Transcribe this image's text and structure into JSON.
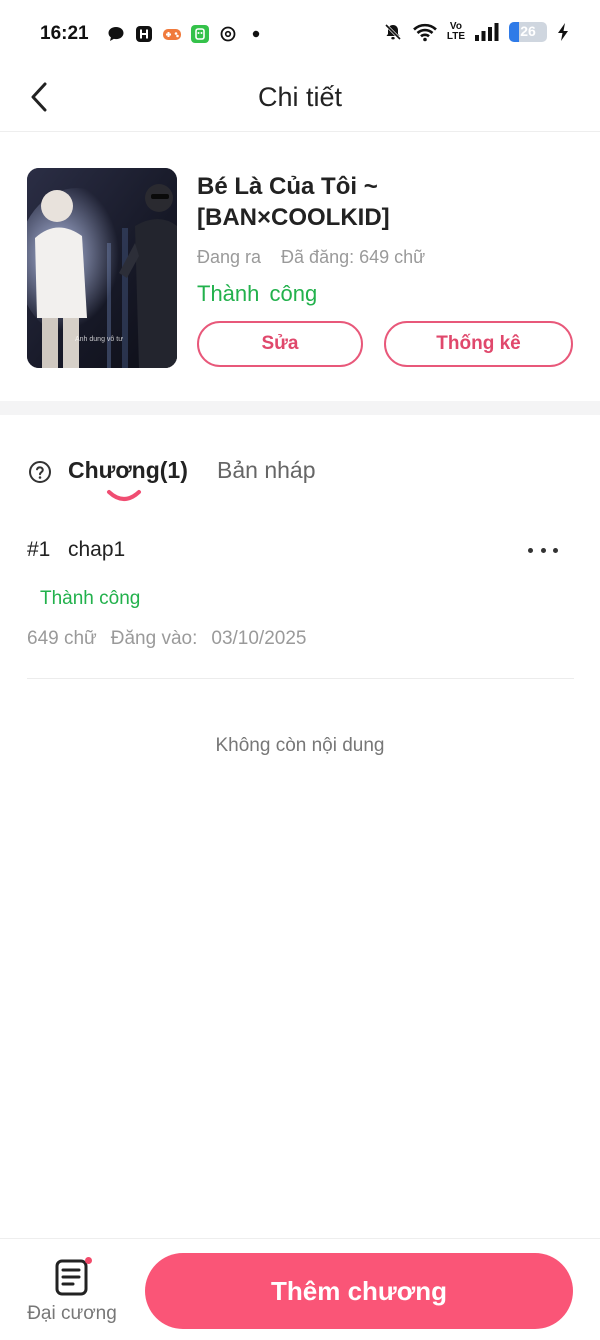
{
  "status_bar": {
    "time": "16:21",
    "left_icons": [
      "chat-bubble-icon",
      "h-app-icon",
      "game-icon",
      "wechat-icon",
      "threads-icon",
      "dot-icon"
    ],
    "right_icons": [
      "bell-muted-icon",
      "wifi-icon",
      "volte-icon",
      "signal-icon",
      "battery-icon",
      "charging-icon"
    ],
    "volte_top": "Vo",
    "volte_bottom": "LTE",
    "battery_level": "26"
  },
  "header": {
    "title": "Chi tiết",
    "back_icon": "chevron-left-icon"
  },
  "book": {
    "title": "Bé Là Của Tôi ~ [BAN×COOLKID]",
    "publish_state": "Đang ra",
    "word_count": "Đã đăng: 649 chữ",
    "status": "Thành công",
    "cover_caption": "Anh dung vô tư",
    "edit_label": "Sửa",
    "stats_label": "Thống kê"
  },
  "tabs": {
    "help_icon": "question-circle-icon",
    "items": [
      {
        "label": "Chương(1)",
        "active": true
      },
      {
        "label": "Bản nháp",
        "active": false
      }
    ]
  },
  "chapters": [
    {
      "number": "#1",
      "title": "chap1",
      "status": "Thành công",
      "words": "649 chữ",
      "published_label": "Đăng vào:",
      "published_date": "03/10/2025"
    }
  ],
  "empty_note": "Không còn nội dung",
  "bottom_bar": {
    "outline_label": "Đại cương",
    "outline_icon": "document-list-icon",
    "add_chapter_label": "Thêm chương"
  },
  "colors": {
    "accent": "#fa5577",
    "success": "#22b14c",
    "muted": "#9a9a9a"
  }
}
